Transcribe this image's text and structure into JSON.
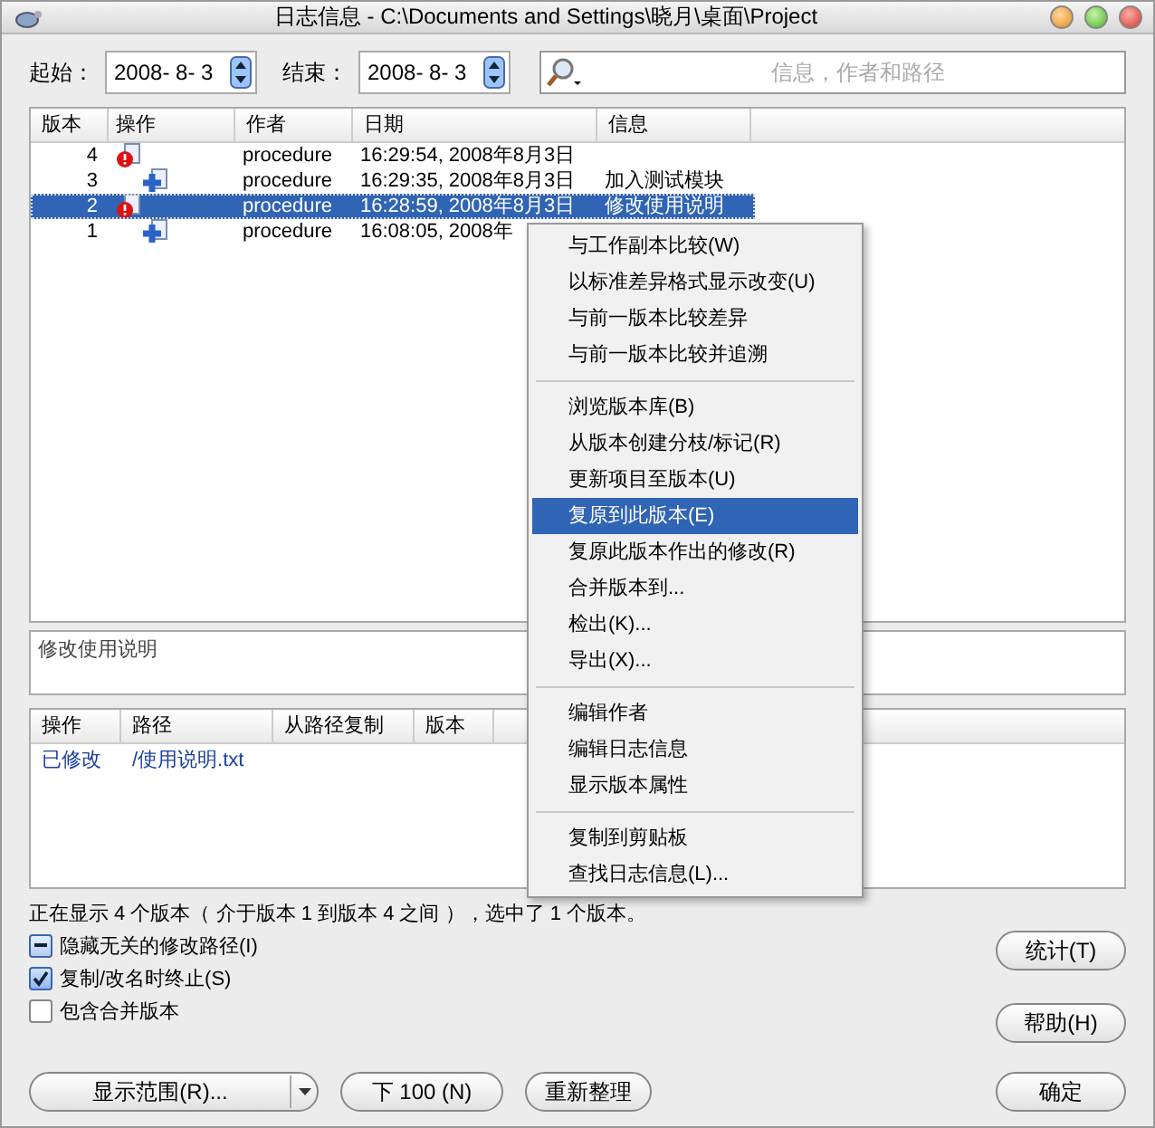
{
  "window": {
    "title": "日志信息 - C:\\Documents and Settings\\晓月\\桌面\\Project"
  },
  "filter": {
    "start_label": "起始：",
    "start_value": "2008- 8- 3",
    "end_label": "结束：",
    "end_value": "2008- 8- 3",
    "search_placeholder": "信息，作者和路径"
  },
  "log_table": {
    "columns": [
      "版本",
      "操作",
      "作者",
      "日期",
      "信息"
    ],
    "rows": [
      {
        "revision": "4",
        "kind": "modified",
        "author": "procedure",
        "date": "16:29:54, 2008年8月3日",
        "selected": false
      },
      {
        "revision": "3",
        "kind": "added",
        "author": "procedure",
        "date": "16:29:35, 2008年8月3日",
        "message": "加入测试模块",
        "selected": false
      },
      {
        "revision": "2",
        "kind": "modified",
        "author": "procedure",
        "date": "16:28:59, 2008年8月3日",
        "message": "修改使用说明",
        "selected": true
      },
      {
        "revision": "1",
        "kind": "added",
        "author": "procedure",
        "date": "16:08:05, 2008年",
        "selected": false
      }
    ]
  },
  "message_box": {
    "text": "修改使用说明"
  },
  "paths_table": {
    "columns": [
      "操作",
      "路径",
      "从路径复制",
      "版本"
    ],
    "rows": [
      {
        "action": "已修改",
        "path": "/使用说明.txt"
      }
    ]
  },
  "status": "正在显示 4 个版本（ 介于版本 1 到版本 4 之间 ），选中了 1 个版本。",
  "options": [
    {
      "label": "隐藏无关的修改路径(I)",
      "checked": false,
      "indeterminate": true
    },
    {
      "label": "复制/改名时终止(S)",
      "checked": true,
      "indeterminate": false
    },
    {
      "label": "包含合并版本",
      "checked": false,
      "indeterminate": false
    }
  ],
  "buttons": {
    "statistics": "统计(T)",
    "help": "帮助(H)",
    "range": "显示范围(R)...",
    "next": "下 100 (N)",
    "refresh": "重新整理",
    "ok": "确定"
  },
  "context_menu": [
    {
      "kind": "item",
      "label": "与工作副本比较(W)",
      "selected": false
    },
    {
      "kind": "item",
      "label": "以标准差异格式显示改变(U)",
      "selected": false
    },
    {
      "kind": "item",
      "label": "与前一版本比较差异",
      "selected": false
    },
    {
      "kind": "item",
      "label": "与前一版本比较并追溯",
      "selected": false
    },
    {
      "kind": "separator"
    },
    {
      "kind": "item",
      "label": "浏览版本库(B)",
      "selected": false
    },
    {
      "kind": "item",
      "label": "从版本创建分枝/标记(R)",
      "selected": false
    },
    {
      "kind": "item",
      "label": "更新项目至版本(U)",
      "selected": false
    },
    {
      "kind": "item",
      "label": "复原到此版本(E)",
      "selected": true
    },
    {
      "kind": "item",
      "label": "复原此版本作出的修改(R)",
      "selected": false
    },
    {
      "kind": "item",
      "label": "合并版本到...",
      "selected": false
    },
    {
      "kind": "item",
      "label": "检出(K)...",
      "selected": false
    },
    {
      "kind": "item",
      "label": "导出(X)...",
      "selected": false
    },
    {
      "kind": "separator"
    },
    {
      "kind": "item",
      "label": "编辑作者",
      "selected": false
    },
    {
      "kind": "item",
      "label": "编辑日志信息",
      "selected": false
    },
    {
      "kind": "item",
      "label": "显示版本属性",
      "selected": false
    },
    {
      "kind": "separator"
    },
    {
      "kind": "item",
      "label": "复制到剪贴板",
      "selected": false
    },
    {
      "kind": "item",
      "label": "查找日志信息(L)...",
      "selected": false
    }
  ]
}
